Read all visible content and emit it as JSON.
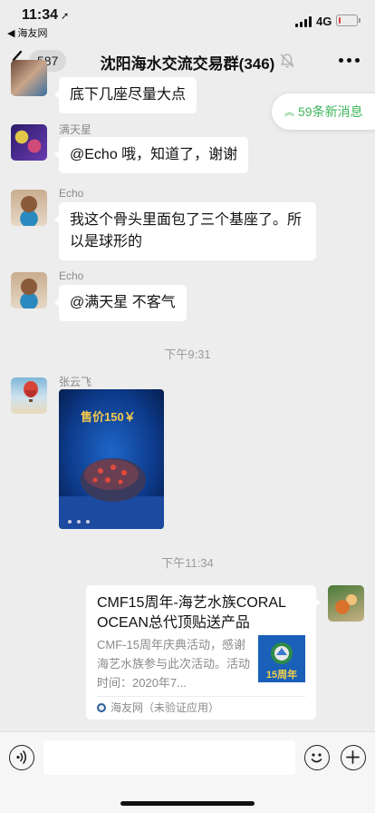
{
  "status_bar": {
    "time": "11:34",
    "back_app": "◀ 海友网",
    "network": "4G",
    "battery_level": 0.12,
    "colors": {
      "battery_low": "#e03a3a"
    }
  },
  "nav": {
    "unread_count": "587",
    "title": "沈阳海水交流交易群(346)",
    "icons": [
      "chevron-left-icon",
      "bell-muted-icon",
      "more-dots-icon"
    ]
  },
  "new_messages_label": "59条新消息",
  "messages": [
    {
      "text": "底下几座尽量大点"
    },
    {
      "sender": "满天星",
      "text": "@Echo 哦，知道了，谢谢"
    },
    {
      "sender": "Echo",
      "text": "我这个骨头里面包了三个基座了。所以是球形的"
    },
    {
      "sender": "Echo",
      "text": "@满天星 不客气"
    }
  ],
  "timestamps": [
    "下午9:31",
    "下午11:34"
  ],
  "image_message": {
    "sender": "张云飞",
    "price_tag": "售价150￥"
  },
  "link_card": {
    "title": "CMF15周年-海艺水族CORAL OCEAN总代顶贴送产品",
    "description": "CMF-15周年庆典活动，感谢海艺水族参与此次活动。活动时间：2020年7...",
    "thumb_text": "15周年",
    "source": "海友网（未验证应用）"
  },
  "input_bar": {
    "icons": [
      "voice-icon",
      "emoji-icon",
      "plus-icon"
    ],
    "placeholder": ""
  },
  "colors": {
    "background": "#ededed",
    "bubble": "#ffffff",
    "accent_green": "#3fb55b"
  }
}
